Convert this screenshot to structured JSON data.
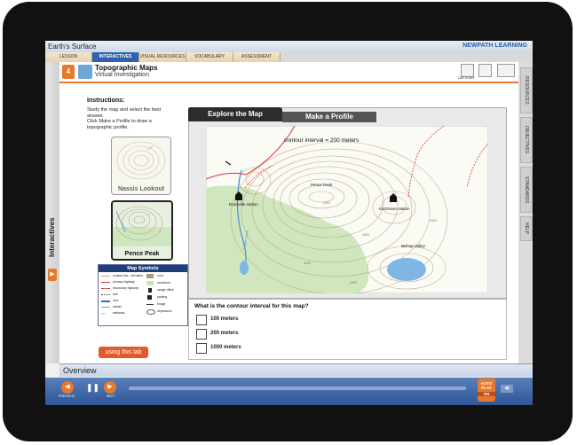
{
  "app": {
    "title": "Earth's Surface",
    "logo": "NEWPATH LEARNING"
  },
  "tabs": [
    {
      "label": "LESSON",
      "active": false
    },
    {
      "label": "INTERACTIVES",
      "active": true
    },
    {
      "label": "VISUAL RESOURCES",
      "active": false
    },
    {
      "label": "VOCABULARY",
      "active": false
    },
    {
      "label": "ASSESSMENT",
      "active": false
    }
  ],
  "left_rail": {
    "label": "Interactives"
  },
  "right_rail": [
    "RESOURCES",
    "OBJECTIVES",
    "STANDARDS",
    "HELP"
  ],
  "header": {
    "number": "4",
    "title": "Topographic Maps",
    "subtitle": "Virtual Investigation",
    "tool_label": "LAB GUIDE"
  },
  "instructions": {
    "title": "Instructions:",
    "lines": [
      "Study the map and select the best",
      "answer.",
      "Click Make a Profile to draw a",
      "topographic profile."
    ]
  },
  "thumbnails": [
    {
      "label": "Nassis Lookout",
      "selected": false
    },
    {
      "label": "Pence Peak",
      "selected": true
    }
  ],
  "symbols": {
    "title": "Map Symbols",
    "items": [
      "contour line - elevation",
      "primary highway",
      "secondary highway",
      "trail",
      "river",
      "stream",
      "wetlands",
      "mud",
      "woodland",
      "ranger office",
      "parking",
      "bridge",
      "depression"
    ]
  },
  "lab_button": "using this lab",
  "map_tabs": [
    "Explore the Map",
    "Make a Profile"
  ],
  "map": {
    "interval_text": "contour interval = 200 meters",
    "labels": [
      "Pence Peak",
      "Dansville station",
      "Kurtztown station",
      "Bishop Valley",
      "Juniper Creek"
    ],
    "elevations": [
      "4000",
      "3000",
      "3000",
      "2000",
      "2000"
    ]
  },
  "question": {
    "text": "What is the contour interval for this map?",
    "options": [
      "100 meters",
      "200 meters",
      "1000 meters"
    ]
  },
  "overview": "Overview",
  "player": {
    "previous": "PREVIOUS",
    "next": "NEXT",
    "autoplay": "AUTO PLAY",
    "autoplay_state": "ON",
    "volume": "◀)"
  },
  "colors": {
    "accent": "#e8792c",
    "nav": "#2e62b0",
    "woodland": "#c9e3b5",
    "lake": "#7fb6e6"
  }
}
